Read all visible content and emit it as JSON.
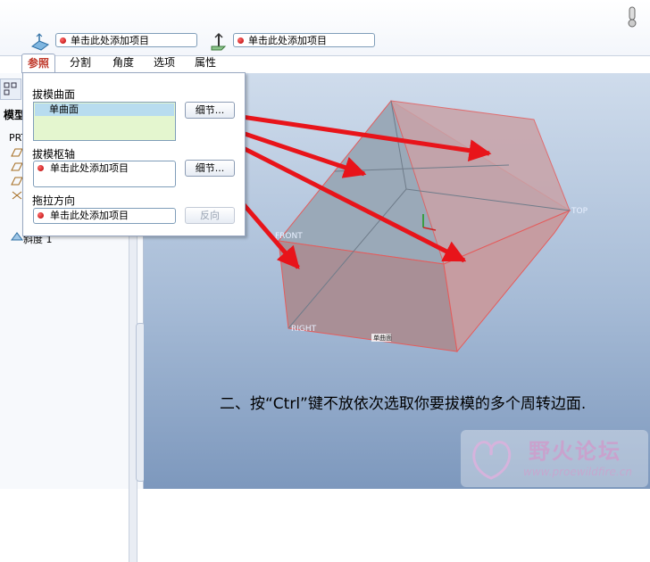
{
  "toolbar": {
    "collector1_text": "单击此处添加项目",
    "collector2_text": "单击此处添加项目"
  },
  "tabs": [
    "参照",
    "分割",
    "角度",
    "选项",
    "属性"
  ],
  "active_tab": "参照",
  "tree": {
    "title": "模型",
    "root_label": "PRT",
    "last_item": "斜度 1"
  },
  "panel": {
    "draft_surfaces_label": "拔模曲面",
    "draft_surfaces_item": "单曲面",
    "draft_surfaces_details": "细节...",
    "draft_hinge_label": "拔模枢轴",
    "draft_hinge_value": "单击此处添加项目",
    "draft_hinge_details": "细节...",
    "pull_direction_label": "拖拉方向",
    "pull_direction_value": "单击此处添加项目",
    "flip_button": "反向"
  },
  "model": {
    "label_front": "FRONT",
    "label_top": "TOP",
    "label_right": "RIGHT",
    "label_surface": "单曲面"
  },
  "annotation": "二、按“Ctrl”键不放依次选取你要拔模的多个周转边面.",
  "watermark": {
    "title": "野火论坛",
    "url": "www.proewildfire.cn"
  },
  "colors": {
    "accent_red": "#e8141a",
    "model_face": "#d4a5a8",
    "selected_edge": "#e45c5c",
    "viewport_top": "#cfdcec",
    "viewport_bottom": "#7d98bd"
  }
}
